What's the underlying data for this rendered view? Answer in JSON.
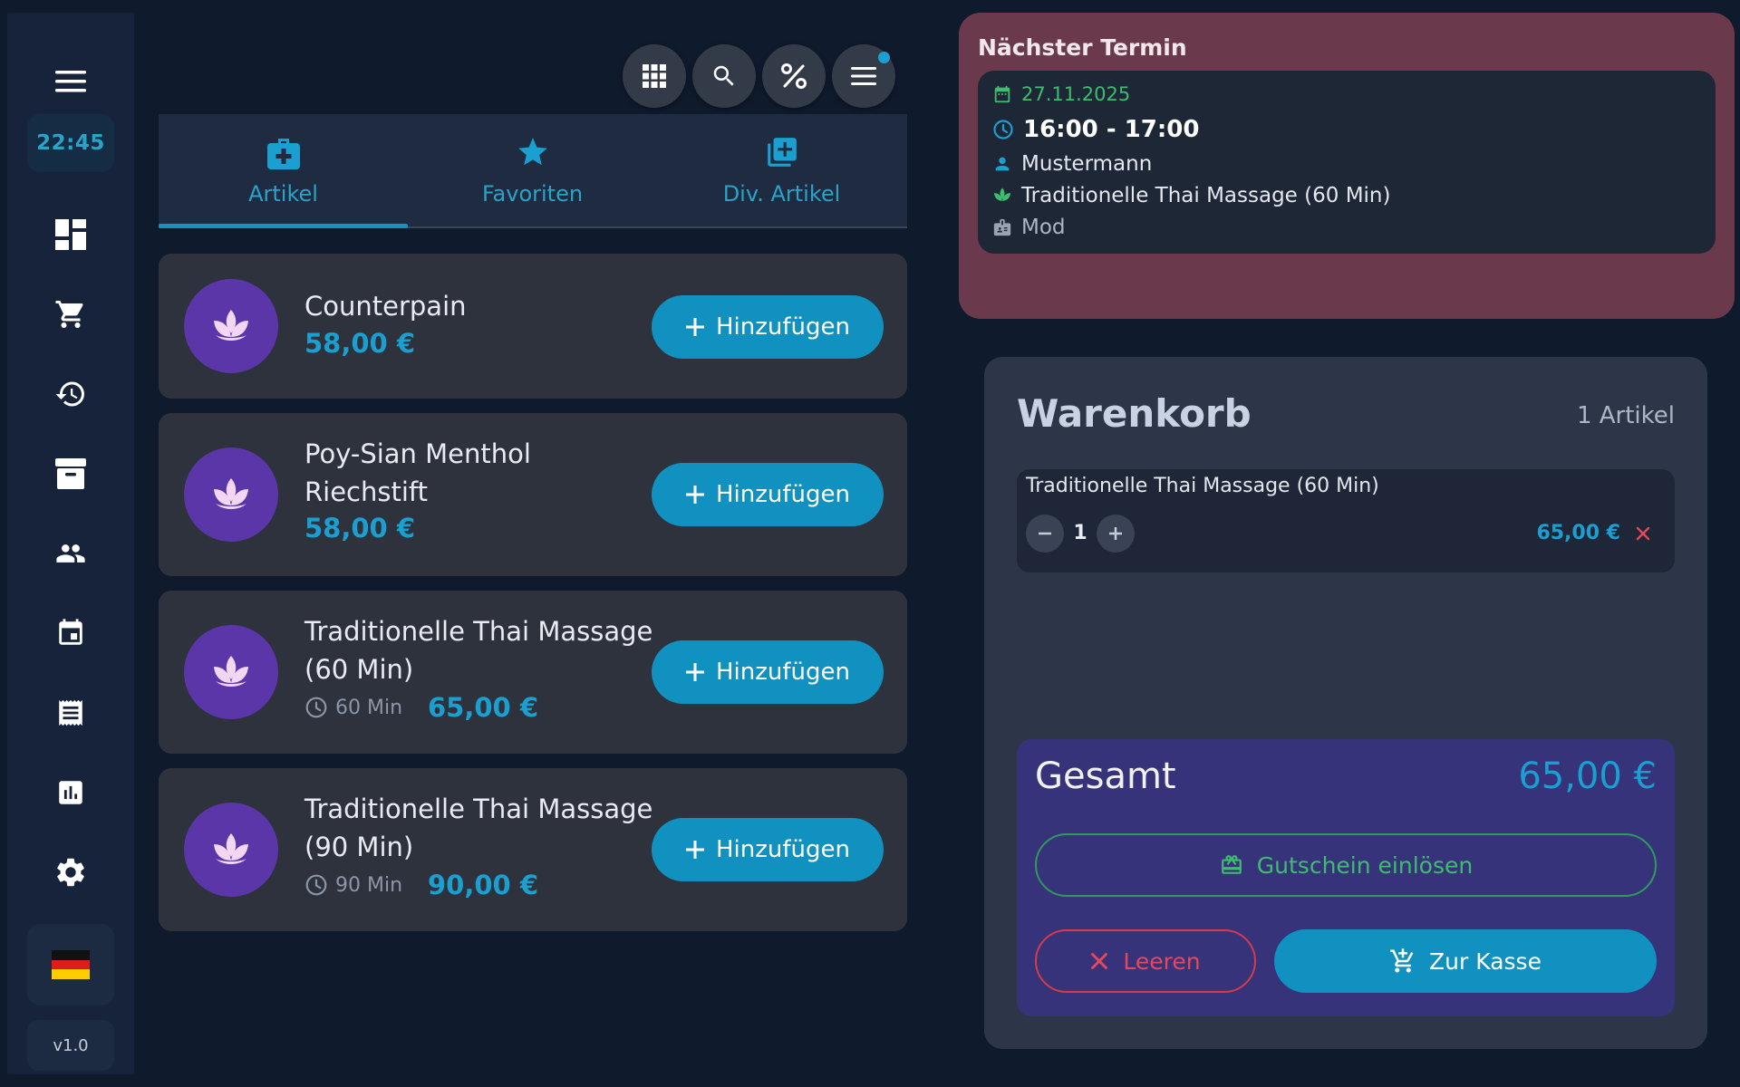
{
  "sidebar": {
    "time": "22:45",
    "version": "v1.0",
    "items": [
      {
        "name": "menu-icon"
      },
      {
        "name": "dashboard-icon"
      },
      {
        "name": "cart-icon"
      },
      {
        "name": "history-icon"
      },
      {
        "name": "archive-icon"
      },
      {
        "name": "customers-icon"
      },
      {
        "name": "calendar-icon"
      },
      {
        "name": "receipt-icon"
      },
      {
        "name": "reports-icon"
      },
      {
        "name": "settings-icon"
      }
    ],
    "language_flag": "de-flag-icon"
  },
  "toolbar": {
    "buttons": [
      "grid-icon",
      "search-icon",
      "percent-icon",
      "menu-list-icon"
    ],
    "has_notification": true
  },
  "tabs": [
    {
      "label": "Artikel",
      "icon": "medical-bag-icon",
      "active": true
    },
    {
      "label": "Favoriten",
      "icon": "star-icon",
      "active": false
    },
    {
      "label": "Div. Artikel",
      "icon": "add-box-icon",
      "active": false
    }
  ],
  "products": [
    {
      "name_line1": "Counterpain",
      "name_line2": "",
      "price": "58,00 €",
      "duration": "",
      "add_label": "Hinzufügen"
    },
    {
      "name_line1": "Poy-Sian Menthol",
      "name_line2": "Riechstift",
      "price": "58,00 €",
      "duration": "",
      "add_label": "Hinzufügen"
    },
    {
      "name_line1": "Traditionelle Thai Massage",
      "name_line2": "(60 Min)",
      "price": "65,00 €",
      "duration": "60 Min",
      "add_label": "Hinzufügen"
    },
    {
      "name_line1": "Traditionelle Thai Massage",
      "name_line2": "(90 Min)",
      "price": "90,00 €",
      "duration": "90 Min",
      "add_label": "Hinzufügen"
    }
  ],
  "next_appointment": {
    "title": "Nächster Termin",
    "date": "27.11.2025",
    "time": "16:00 - 17:00",
    "customer": "Mustermann",
    "service": "Traditionelle Thai Massage (60 Min)",
    "staff": "Mod"
  },
  "cart": {
    "title": "Warenkorb",
    "count": "1 Artikel",
    "items": [
      {
        "name": "Traditionelle Thai Massage (60 Min)",
        "qty": "1",
        "price": "65,00 €"
      }
    ],
    "total_label": "Gesamt",
    "total_value": "65,00 €",
    "voucher_label": "Gutschein einlösen",
    "clear_label": "Leeren",
    "checkout_label": "Zur Kasse"
  },
  "colors": {
    "accent": "#1191c0",
    "price": "#1b9fd0",
    "appointment_bg": "#6a3a4c",
    "voucher": "#3dbd6e",
    "danger": "#e5485a",
    "avatar": "#5a36a8"
  }
}
